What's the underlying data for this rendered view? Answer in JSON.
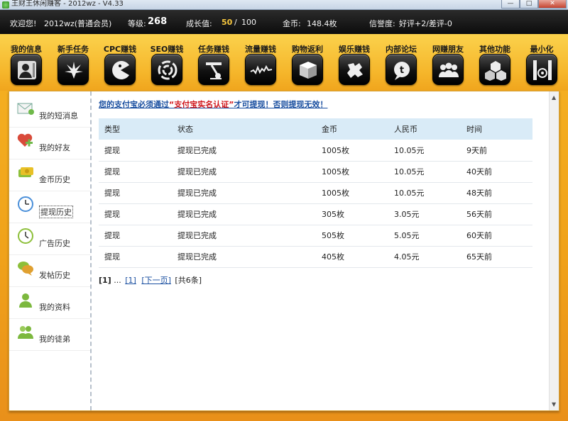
{
  "window": {
    "title": "王财王休闲赚客 - 2012wz - V4.33",
    "minimize": "—",
    "maximize": "□",
    "close": "✕"
  },
  "status": {
    "welcome": "欢迎您!",
    "username": "2012wz(普通会员)",
    "level_label": "等级:",
    "level_value": "268",
    "growth_label": "成长值:",
    "growth_value": "50",
    "growth_sep": "/",
    "growth_max": "100",
    "coins_label": "金币:",
    "coins_value": "148.4枚",
    "credit_label": "信誉度:",
    "credit_value": "好评+2/差评-0"
  },
  "toolbar": {
    "items": [
      {
        "label": "我的信息",
        "icon": "person-icon"
      },
      {
        "label": "新手任务",
        "icon": "leaf-icon"
      },
      {
        "label": "CPC赚钱",
        "icon": "pacman-icon"
      },
      {
        "label": "SEO赚钱",
        "icon": "swirl-icon"
      },
      {
        "label": "任务赚钱",
        "icon": "joystick-icon"
      },
      {
        "label": "流量赚钱",
        "icon": "wave-icon"
      },
      {
        "label": "购物返利",
        "icon": "box-icon"
      },
      {
        "label": "娱乐赚钱",
        "icon": "puzzle-icon"
      },
      {
        "label": "内部论坛",
        "icon": "chat-icon"
      },
      {
        "label": "网赚朋友",
        "icon": "group-icon"
      },
      {
        "label": "其他功能",
        "icon": "cubes-icon"
      },
      {
        "label": "最小化",
        "icon": "minimize-icon"
      }
    ]
  },
  "sidebar": {
    "items": [
      {
        "label": "我的短消息",
        "icon": "mail-icon",
        "color": "#6fb94a"
      },
      {
        "label": "我的好友",
        "icon": "heart-plus-icon",
        "color": "#d94a3a"
      },
      {
        "label": "金币历史",
        "icon": "money-icon",
        "color": "#e8c026"
      },
      {
        "label": "提现历史",
        "icon": "clock-icon",
        "color": "#4a8fd9"
      },
      {
        "label": "广告历史",
        "icon": "clock-green-icon",
        "color": "#8dbf3a"
      },
      {
        "label": "发帖历史",
        "icon": "speech-icon",
        "color": "#e0a030"
      },
      {
        "label": "我的资料",
        "icon": "user-icon",
        "color": "#7cb83e"
      },
      {
        "label": "我的徒弟",
        "icon": "users-icon",
        "color": "#7cb83e"
      }
    ],
    "active_index": 3
  },
  "notice": {
    "prefix": "您的支付宝必须通过",
    "highlight": "“支付宝实名认证”",
    "suffix": "才可提现！否则提现无效！"
  },
  "table": {
    "headers": [
      "类型",
      "状态",
      "金币",
      "人民币",
      "时间"
    ],
    "rows": [
      [
        "提现",
        "提现已完成",
        "1005枚",
        "10.05元",
        "9天前"
      ],
      [
        "提现",
        "提现已完成",
        "1005枚",
        "10.05元",
        "40天前"
      ],
      [
        "提现",
        "提现已完成",
        "1005枚",
        "10.05元",
        "48天前"
      ],
      [
        "提现",
        "提现已完成",
        "305枚",
        "3.05元",
        "56天前"
      ],
      [
        "提现",
        "提现已完成",
        "505枚",
        "5.05元",
        "60天前"
      ],
      [
        "提现",
        "提现已完成",
        "405枚",
        "4.05元",
        "65天前"
      ]
    ]
  },
  "pager": {
    "current": "[1]",
    "ellipsis": "...",
    "page_link": "[1]",
    "next": "[下一页]",
    "total": "[共6条]"
  },
  "colors": {
    "accent": "#f5b52a",
    "status_bg": "#111111",
    "link": "#1a4fa0",
    "warning": "#d0161b",
    "table_header": "#d9ebf7"
  }
}
